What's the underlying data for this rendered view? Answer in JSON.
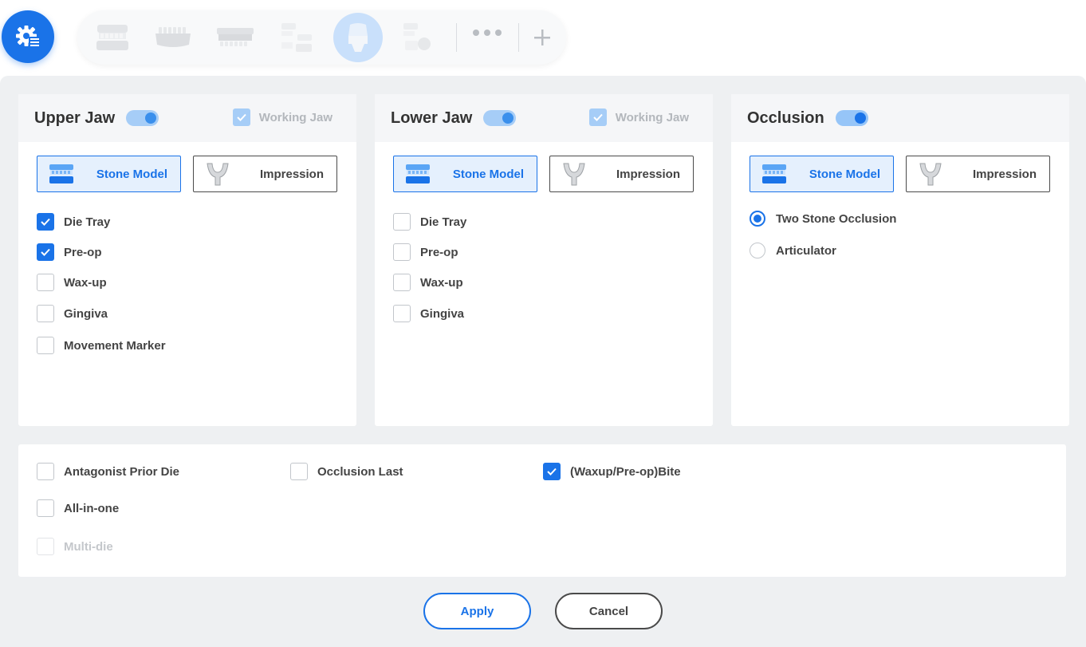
{
  "toolbar": {
    "icons": [
      "settings-gear-icon",
      "upper-jaw-model-icon",
      "lower-jaw-model-icon",
      "flat-model-icon",
      "split-jaw-icon",
      "single-tooth-icon",
      "tooth-with-die-icon",
      "more-dots-icon",
      "add-plus-icon"
    ],
    "active_index": 5,
    "accent_color": "#1a73e8"
  },
  "panels": {
    "upper": {
      "title": "Upper Jaw",
      "toggle_on": true,
      "working_jaw_label": "Working Jaw",
      "stone_model_label": "Stone Model",
      "impression_label": "Impression",
      "options": [
        {
          "label": "Die Tray",
          "checked": true
        },
        {
          "label": "Pre-op",
          "checked": true
        },
        {
          "label": "Wax-up",
          "checked": false
        },
        {
          "label": "Gingiva",
          "checked": false
        },
        {
          "label": "Movement Marker",
          "checked": false
        }
      ]
    },
    "lower": {
      "title": "Lower Jaw",
      "toggle_on": true,
      "working_jaw_label": "Working Jaw",
      "stone_model_label": "Stone Model",
      "impression_label": "Impression",
      "options": [
        {
          "label": "Die Tray",
          "checked": false
        },
        {
          "label": "Pre-op",
          "checked": false
        },
        {
          "label": "Wax-up",
          "checked": false
        },
        {
          "label": "Gingiva",
          "checked": false
        }
      ]
    },
    "occlusion": {
      "title": "Occlusion",
      "toggle_on": true,
      "stone_model_label": "Stone Model",
      "impression_label": "Impression",
      "radios": [
        {
          "label": "Two Stone Occlusion",
          "selected": true
        },
        {
          "label": "Articulator",
          "selected": false
        }
      ]
    }
  },
  "extras": {
    "antagonist_prior_die": "Antagonist Prior Die",
    "occlusion_last": "Occlusion Last",
    "waxup_preop_bite": "(Waxup/Pre-op)Bite",
    "all_in_one": "All-in-one",
    "multi_die": "Multi-die"
  },
  "buttons": {
    "apply": "Apply",
    "cancel": "Cancel"
  }
}
